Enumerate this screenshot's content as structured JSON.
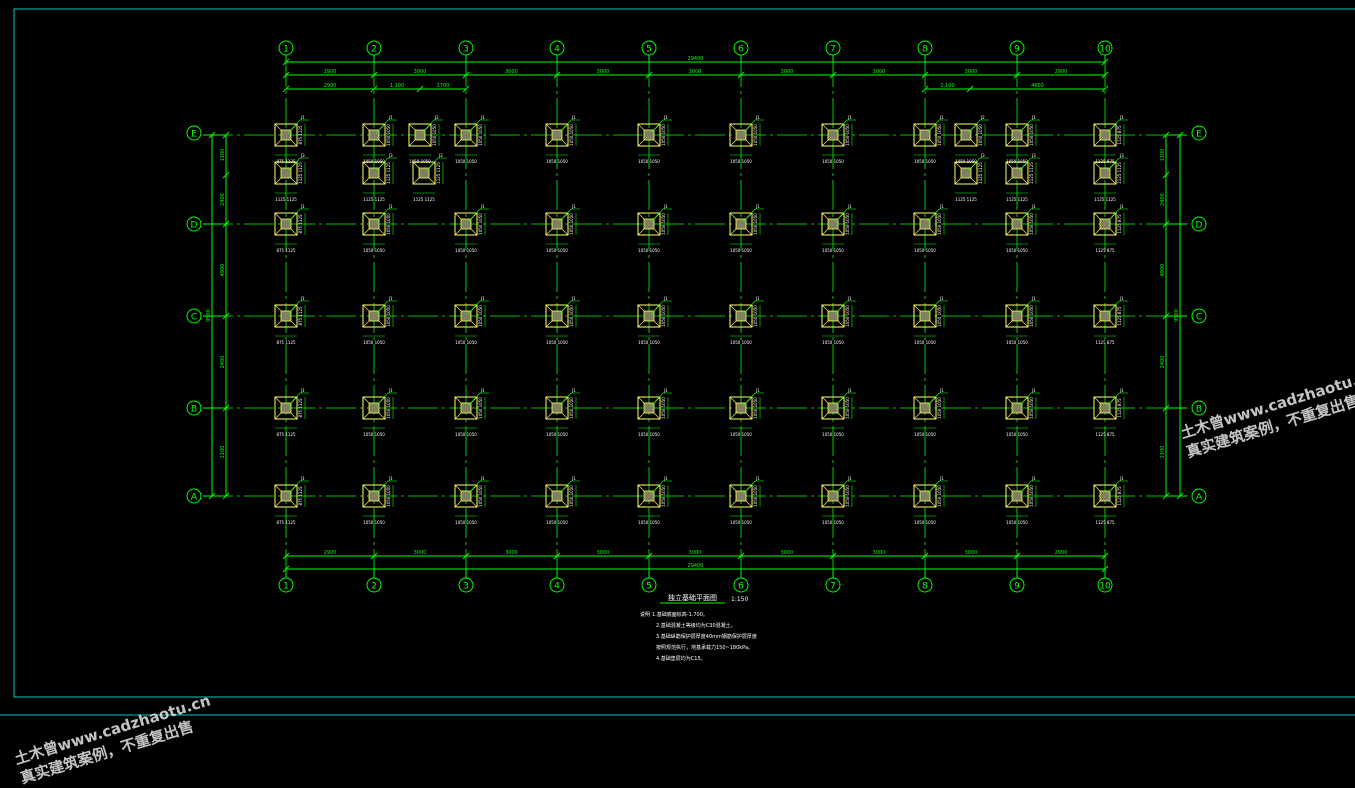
{
  "colors": {
    "background": "#000000",
    "frame": "#00c8c8",
    "grid": "#00ff00",
    "footing": "#ffff66",
    "text": "#ffffff"
  },
  "axes": {
    "columns": [
      "1",
      "2",
      "3",
      "4",
      "5",
      "6",
      "7",
      "8",
      "9",
      "10"
    ],
    "rows": [
      "E",
      "D",
      "C",
      "B",
      "A"
    ]
  },
  "dimensions": {
    "overall": "29400",
    "column_spacings": [
      "2900",
      "3000",
      "3000",
      "3000",
      "3000",
      "3000",
      "3000",
      "3000",
      "2900"
    ],
    "sub_spacings_left": [
      "2900",
      "1,100",
      "1700"
    ],
    "sub_spacings_right": [
      "1700",
      "1,100",
      "4600"
    ],
    "row_spacings": [
      "1100",
      "2400",
      "4900",
      "2400",
      "1100"
    ],
    "row_total": "9500"
  },
  "footing_tags": [
    "J1",
    "J2",
    "J3"
  ],
  "footing_dims": [
    "1125 1125",
    "1050 1050",
    "875 1125",
    "1125 875"
  ],
  "title": {
    "name": "独立基础平面图",
    "scale": "1:150"
  },
  "notes": {
    "heading": "说明",
    "items": [
      "1.基础底面标高-1.700。",
      "2.基础混凝土等级均为C30混凝土。",
      "3.基础纵筋保护层厚度40mm钢筋保护层厚度",
      "  按照规范执行，地基承载力150~180kPa。",
      "4.基础垫层均为C15。"
    ]
  },
  "watermarks": [
    {
      "line1": "土木曾www.cadzhaotu.cn",
      "line2": "真实建筑案例，不重复出售"
    },
    {
      "line1": "土木曾www.cadzhaotu.cn",
      "line2": "真实建筑案例，不重复出售"
    }
  ]
}
